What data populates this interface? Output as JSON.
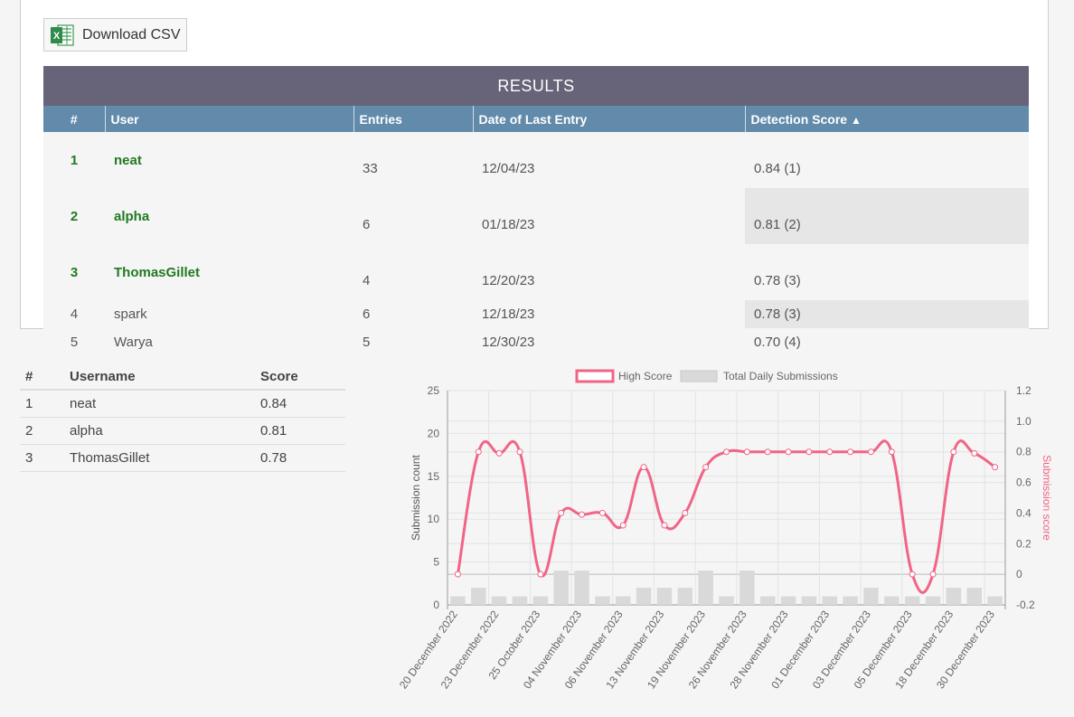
{
  "toolbar": {
    "download_label": "Download CSV"
  },
  "results": {
    "title": "RESULTS",
    "columns": [
      "#",
      "User",
      "Entries",
      "Date of Last Entry",
      "Detection Score"
    ],
    "sort_indicator": "▲",
    "rows": [
      {
        "rank": "1",
        "user": "neat",
        "entries": "33",
        "date": "12/04/23",
        "score": "0.84 (1)"
      },
      {
        "rank": "2",
        "user": "alpha",
        "entries": "6",
        "date": "01/18/23",
        "score": "0.81 (2)"
      },
      {
        "rank": "3",
        "user": "ThomasGillet",
        "entries": "4",
        "date": "12/20/23",
        "score": "0.78 (3)"
      },
      {
        "rank": "4",
        "user": "spark",
        "entries": "6",
        "date": "12/18/23",
        "score": "0.78 (3)"
      },
      {
        "rank": "5",
        "user": "Warya",
        "entries": "5",
        "date": "12/30/23",
        "score": "0.70 (4)"
      }
    ]
  },
  "leaderboard": {
    "columns": [
      "#",
      "Username",
      "Score"
    ],
    "rows": [
      {
        "rank": "1",
        "user": "neat",
        "score": "0.84"
      },
      {
        "rank": "2",
        "user": "alpha",
        "score": "0.81"
      },
      {
        "rank": "3",
        "user": "ThomasGillet",
        "score": "0.78"
      }
    ]
  },
  "colors": {
    "header": "#676379",
    "subheader": "#628aab",
    "top_user": "#217a21",
    "line": "#f06585",
    "bar": "#d9d9d9"
  },
  "chart_data": {
    "type": "bar+line",
    "legend": [
      "High Score",
      "Total Daily Submissions"
    ],
    "legend_position": "top",
    "y_left_label": "Submission count",
    "y_right_label": "Submission score",
    "y_left_range": [
      0,
      25
    ],
    "y_left_ticks": [
      "0",
      "5",
      "10",
      "15",
      "20",
      "25"
    ],
    "y_right_range": [
      -0.2,
      1.2
    ],
    "y_right_ticks": [
      "-0.2",
      "0",
      "0.2",
      "0.4",
      "0.6",
      "0.8",
      "1.0",
      "1.2"
    ],
    "x_tick_labels": [
      "20 December 2022",
      "23 December 2022",
      "25 October 2023",
      "04 November 2023",
      "06 November 2023",
      "13 November 2023",
      "19 November 2023",
      "26 November 2023",
      "28 November 2023",
      "01 December 2023",
      "03 December 2023",
      "05 December 2023",
      "18 December 2023",
      "30 December 2023"
    ],
    "points": 27,
    "bar_values": [
      1,
      2,
      1,
      1,
      1,
      4,
      4,
      1,
      1,
      2,
      2,
      2,
      4,
      1,
      4,
      1,
      1,
      1,
      1,
      1,
      2,
      1,
      1,
      1,
      2,
      2,
      1
    ],
    "line_values": [
      0,
      0.8,
      0.79,
      0.8,
      0,
      0.4,
      0.39,
      0.4,
      0.32,
      0.7,
      0.32,
      0.4,
      0.7,
      0.8,
      0.8,
      0.8,
      0.8,
      0.8,
      0.8,
      0.8,
      0.8,
      0.8,
      0,
      0,
      0.8,
      0.79,
      0.7
    ]
  }
}
